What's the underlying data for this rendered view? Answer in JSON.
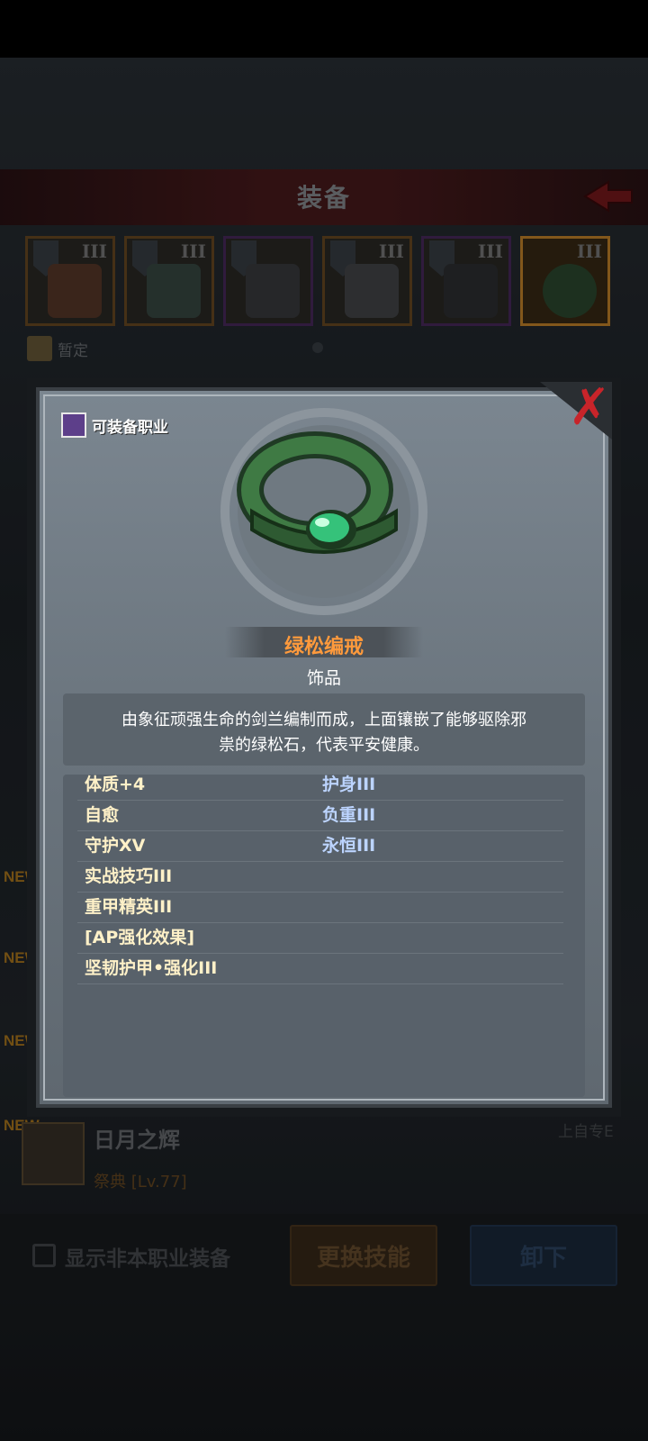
{
  "header": {
    "title": "装备"
  },
  "slots": [
    {
      "tier": "III",
      "border": "orange"
    },
    {
      "tier": "III",
      "border": "orange"
    },
    {
      "tier": "",
      "border": "purple"
    },
    {
      "tier": "III",
      "border": "orange"
    },
    {
      "tier": "III",
      "border": "purple"
    },
    {
      "tier": "III",
      "border": "gold"
    }
  ],
  "tentative_label": "暂定",
  "list": {
    "new_tag": "NEW",
    "item_name": "日月之辉",
    "item_sub": "祭典 [Lv.77]",
    "item_right": "上自专E"
  },
  "bottom": {
    "show_other_label": "显示非本职业装备",
    "change_skill_label": "更换技能",
    "unequip_label": "卸下"
  },
  "modal": {
    "job_label": "可装备职业",
    "close_glyph": "✗",
    "item_name": "绿松编戒",
    "item_type": "饰品",
    "description_line1": "由象征顽强生命的剑兰编制而成，上面镶嵌了能够驱除邪",
    "description_line2": "祟的绿松石，代表平安健康。",
    "stats_left": [
      "体质+4",
      "自愈",
      "守护XV",
      "实战技巧III",
      "重甲精英III",
      "[AP强化效果]",
      "坚韧护甲•强化III"
    ],
    "stats_right": [
      "护身III",
      "负重III",
      "永恒III"
    ]
  },
  "colors": {
    "item_name": "#ff9a3c",
    "close": "#c8242a",
    "stat_left": "#fff1c8",
    "stat_right": "#bcd4ff"
  }
}
